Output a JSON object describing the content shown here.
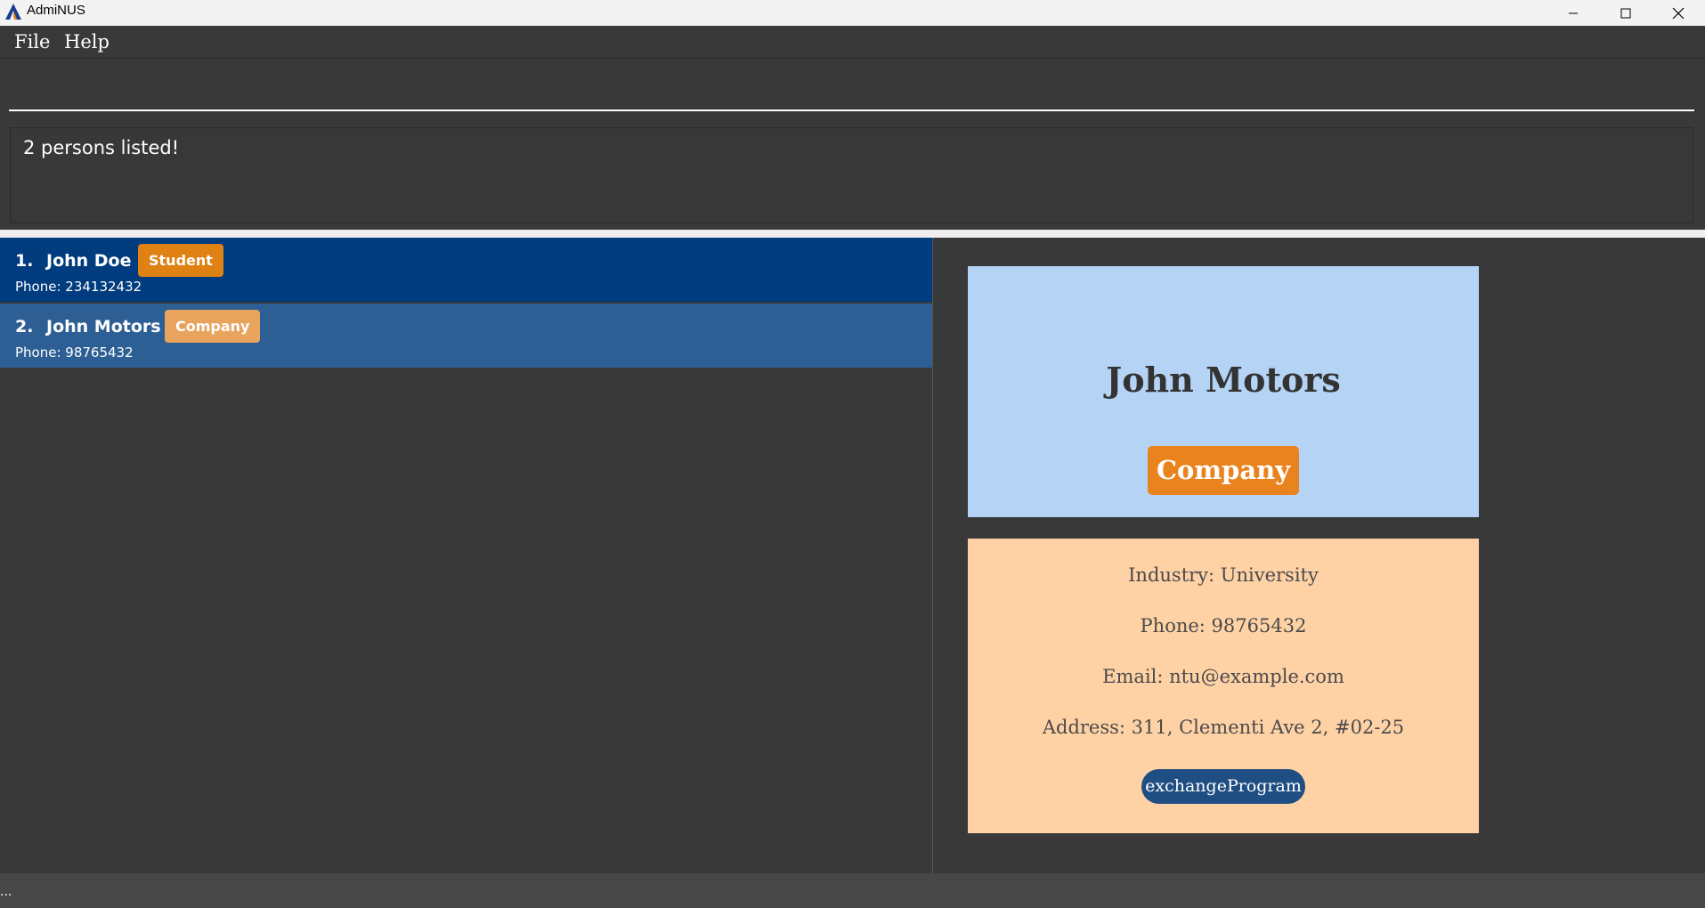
{
  "window": {
    "title": "AdmiNUS",
    "app_icon": "adminus-a-logo-icon",
    "controls": [
      "minimize-icon",
      "maximize-icon",
      "close-icon"
    ]
  },
  "menu": {
    "items": [
      {
        "label": "File"
      },
      {
        "label": "Help"
      }
    ]
  },
  "command": {
    "value": "",
    "placeholder": ""
  },
  "result": {
    "text": "2 persons listed!"
  },
  "person_list": {
    "items": [
      {
        "index": "1.",
        "name": "John Doe",
        "tag": "Student",
        "phone": "Phone: 234132432"
      },
      {
        "index": "2.",
        "name": "John Motors",
        "tag": "Company",
        "phone": "Phone: 98765432"
      }
    ]
  },
  "detail": {
    "name": "John Motors",
    "tag": "Company",
    "industry": "Industry: University",
    "phone": "Phone: 98765432",
    "email": "Email: ntu@example.com",
    "address": "Address: 311, Clementi Ave 2, #02-25",
    "program_tag": "exchangeProgram"
  },
  "status": {
    "text": "..."
  },
  "colors": {
    "selected_row": "#003c7e",
    "row": "#2d5f94",
    "student_tag": "#e08114",
    "company_tag": "#e8a45c",
    "header_card": "#b4d3f5",
    "info_card": "#ffd2a6",
    "program_tag": "#1f4e83"
  }
}
